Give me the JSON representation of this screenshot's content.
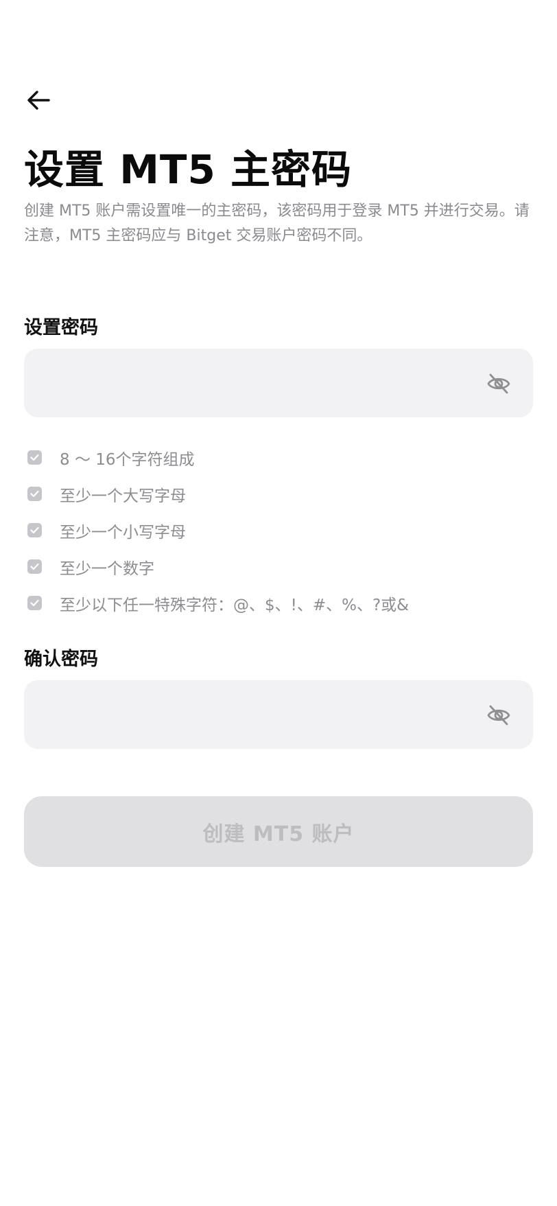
{
  "header": {
    "back_icon": "arrow-left-icon",
    "title": "设置 MT5 主密码",
    "subtitle": "创建 MT5 账户需设置唯一的主密码，该密码用于登录 MT5 并进行交易。请注意，MT5 主密码应与 Bitget 交易账户密码不同。"
  },
  "password": {
    "label": "设置密码",
    "value": "",
    "visibility_icon": "eye-off-icon"
  },
  "rules": [
    {
      "text": "8 ～ 16个字符组成",
      "met": true
    },
    {
      "text": "至少一个大写字母",
      "met": true
    },
    {
      "text": "至少一个小写字母",
      "met": true
    },
    {
      "text": "至少一个数字",
      "met": true
    },
    {
      "text": "至少以下任一特殊字符：@、$、!、#、%、?或&",
      "met": true
    }
  ],
  "confirm": {
    "label": "确认密码",
    "value": "",
    "visibility_icon": "eye-off-icon"
  },
  "submit": {
    "label": "创建 MT5 账户",
    "enabled": false
  },
  "colors": {
    "field_bg": "#f2f2f4",
    "button_disabled_bg": "#e0e0e2",
    "button_disabled_text": "#bdbdc1",
    "muted_text": "#8a8a8f"
  }
}
